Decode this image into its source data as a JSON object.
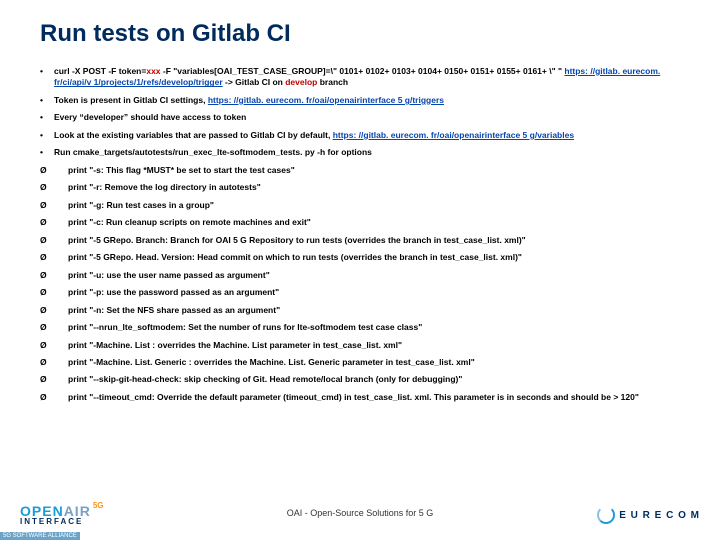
{
  "title": "Run tests on Gitlab CI",
  "items": [
    {
      "type": "bullet",
      "html": "curl -X POST -F token=<span class='red'>xxx</span> -F \"variables[OAI_TEST_CASE_GROUP]=\\\" 0101+ 0102+ 0103+ 0104+ 0150+ 0151+ 0155+ 0161+ \\\" \" <a class='link'>https: //gitlab. eurecom. fr/ci/api/v 1/projects/1/refs/develop/trigger</a>  -> Gitlab CI on <span class='red'>develop</span> branch"
    },
    {
      "type": "bullet",
      "html": "Token is present in Gitlab CI settings, <a class='link'>https: //gitlab. eurecom. fr/oai/openairinterface 5 g/triggers</a>"
    },
    {
      "type": "bullet",
      "html": "Every “developer” should have access to token"
    },
    {
      "type": "bullet",
      "html": "Look at the existing variables that are passed to Gitlab CI by default, <a class='link'>https: //gitlab. eurecom. fr/oai/openairinterface 5 g/variables</a>"
    },
    {
      "type": "bullet",
      "html": "Run cmake_targets/autotests/run_exec_lte-softmodem_tests. py -h for options"
    },
    {
      "type": "arrow",
      "html": "print \"-s:  This flag *MUST* be set to start the test cases\""
    },
    {
      "type": "arrow",
      "html": "print \"-r:  Remove the log directory in autotests\""
    },
    {
      "type": "arrow",
      "html": "print \"-g:  Run test cases in a group\""
    },
    {
      "type": "arrow",
      "html": "print \"-c:  Run cleanup scripts on remote machines and exit\""
    },
    {
      "type": "arrow",
      "html": "print \"-5 GRepo. Branch:  Branch for OAI 5 G Repository to run tests (overrides the branch in test_case_list. xml)\""
    },
    {
      "type": "arrow",
      "html": "print \"-5 GRepo. Head. Version:  Head commit on which to run tests (overrides the branch in test_case_list. xml)\""
    },
    {
      "type": "arrow",
      "html": "print \"-u:  use the user name passed as argument\""
    },
    {
      "type": "arrow",
      "html": "print \"-p:  use the password passed as an argument\""
    },
    {
      "type": "arrow",
      "html": "print \"-n:  Set the NFS share passed as an argument\""
    },
    {
      "type": "arrow",
      "html": "print \"--nrun_lte_softmodem:  Set the number of runs for lte-softmodem test case class\""
    },
    {
      "type": "arrow",
      "html": "print \"-Machine. List : overrides the Machine. List parameter in test_case_list. xml\""
    },
    {
      "type": "arrow",
      "html": "print \"-Machine. List. Generic : overrides the Machine. List. Generic  parameter in test_case_list. xml\""
    },
    {
      "type": "arrow",
      "html": "print \"--skip-git-head-check: skip checking of Git. Head remote/local branch (only for debugging)\""
    },
    {
      "type": "arrow",
      "html": "print \"--timeout_cmd: Override the default parameter (timeout_cmd) in test_case_list. xml. This parameter is in seconds and should be > 120\""
    }
  ],
  "footer_center": "OAI - Open-Source Solutions for 5 G",
  "logo_left": {
    "l1a": "OPEN",
    "l1b": "AIR",
    "sg": "5G",
    "l2": "INTERFACE",
    "tag": "5G SOFTWARE ALLIANCE"
  },
  "logo_right": "E U R E C O M"
}
